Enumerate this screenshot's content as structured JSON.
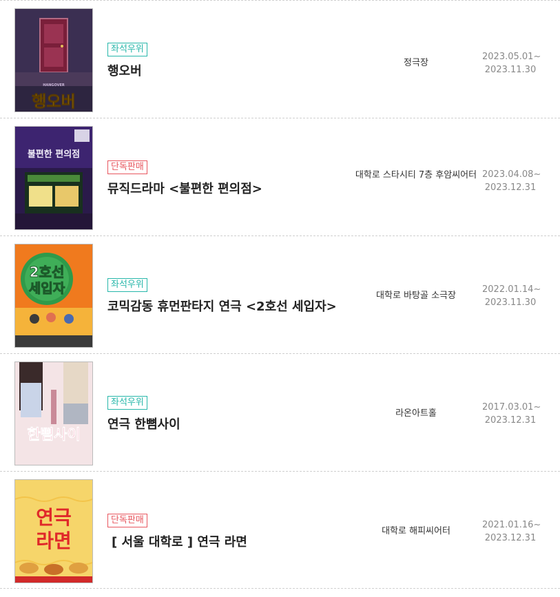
{
  "shows": [
    {
      "badge": "좌석우위",
      "badge_color": "#27b7aa",
      "title": "행오버",
      "venue": "정극장",
      "period_start": "2023.05.01~",
      "period_end": "2023.11.30",
      "poster": {
        "big_text": "행오버",
        "small_text": "HANGOVER"
      }
    },
    {
      "badge": "단독판매",
      "badge_color": "#e8565e",
      "title": "뮤직드라마 <불편한 편의점>",
      "venue": "대학로 스타시티 7층 후암씨어터",
      "period_start": "2023.04.08~",
      "period_end": "2023.12.31",
      "poster": {
        "big_text": "불편한 편의점"
      }
    },
    {
      "badge": "좌석우위",
      "badge_color": "#27b7aa",
      "title": "코믹감동 휴먼판타지 연극 <2호선 세입자>",
      "venue": "대학로 바탕골 소극장",
      "period_start": "2022.01.14~",
      "period_end": "2023.11.30",
      "poster": {
        "big_text_1": "2호선",
        "big_text_2": "세입자"
      }
    },
    {
      "badge": "좌석우위",
      "badge_color": "#27b7aa",
      "title": "연극 한뼘사이",
      "venue": "라온아트홀",
      "period_start": "2017.03.01~",
      "period_end": "2023.12.31",
      "poster": {
        "big_text": "한뼘사이"
      }
    },
    {
      "badge": "단독판매",
      "badge_color": "#e8565e",
      "title": "[ 서울 대학로 ] 연극 라면",
      "venue": "대학로 해피씨어터",
      "period_start": "2021.01.16~",
      "period_end": "2023.12.31",
      "poster": {
        "big_text_1": "연극",
        "big_text_2": "라면"
      }
    }
  ]
}
